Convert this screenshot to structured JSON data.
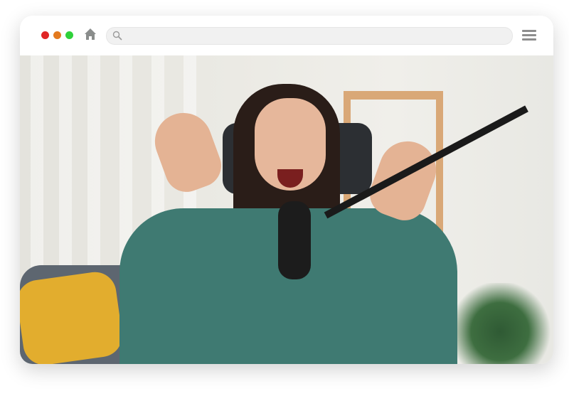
{
  "browser": {
    "window_controls": [
      {
        "name": "close",
        "color": "#e02525"
      },
      {
        "name": "minimize",
        "color": "#e37a1f"
      },
      {
        "name": "maximize",
        "color": "#2fd13a"
      }
    ],
    "home_icon": "home-icon",
    "address_bar": {
      "value": "",
      "icon": "search-icon"
    },
    "menu_icon": "hamburger-menu-icon"
  },
  "content": {
    "image": "podcaster-with-headphones-and-microphone-photo"
  }
}
